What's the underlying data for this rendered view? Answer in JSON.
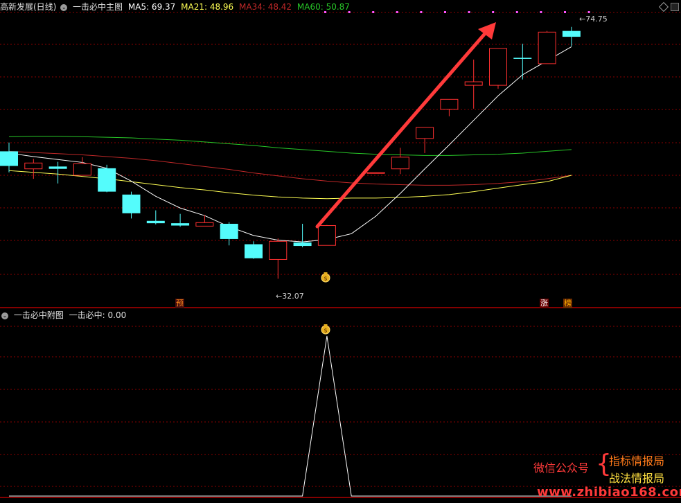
{
  "main_header": {
    "stock_title": "高新发展(日线)",
    "indicator_name": "一击必中主图",
    "ma5": "MA5: 69.37",
    "ma21": "MA21: 48.96",
    "ma34": "MA34: 48.42",
    "ma60": "MA60: 50.87"
  },
  "sub_header": {
    "indicator_name": "一击必中附图",
    "value": "一击必中: 0.00"
  },
  "price_labels": {
    "high": "74.75",
    "low": "32.07"
  },
  "badges": {
    "yu": "预",
    "zhang": "涨",
    "bang": "榜"
  },
  "colors": {
    "up": "#ff3030",
    "down": "#54fcfc",
    "ma5": "#ffffff",
    "ma21": "#ffff54",
    "ma34": "#c02828",
    "ma60": "#28c828",
    "grid": "#8b0000",
    "arrow": "#ff3a3a",
    "marker": "#ff54ff"
  },
  "icons": {
    "collapse": "chevron-down-icon",
    "signal": "money-bag-icon",
    "expand": "diamond-icon"
  },
  "watermark": {
    "left": "微信公众号",
    "right_top": "指标情报局",
    "right_bottom": "战法情报局",
    "url": "www.zhibiao168.com"
  },
  "chart_data": [
    {
      "type": "candlestick",
      "title": "高新发展(日线)",
      "ylim": [
        30,
        76
      ],
      "candles": [
        {
          "o": 53.9,
          "h": 55.4,
          "l": 50.3,
          "c": 51.4
        },
        {
          "o": 50.9,
          "h": 52.6,
          "l": 49.2,
          "c": 51.9
        },
        {
          "o": 51.3,
          "h": 52.1,
          "l": 48.4,
          "c": 50.9
        },
        {
          "o": 49.8,
          "h": 52.9,
          "l": 49.8,
          "c": 51.8
        },
        {
          "o": 51.0,
          "h": 51.6,
          "l": 46.9,
          "c": 47.0
        },
        {
          "o": 46.5,
          "h": 47.0,
          "l": 42.4,
          "c": 43.3
        },
        {
          "o": 42.0,
          "h": 43.8,
          "l": 41.4,
          "c": 41.6
        },
        {
          "o": 41.6,
          "h": 43.2,
          "l": 41.0,
          "c": 41.2
        },
        {
          "o": 41.1,
          "h": 43.0,
          "l": 41.1,
          "c": 41.7
        },
        {
          "o": 41.5,
          "h": 41.8,
          "l": 37.8,
          "c": 38.9
        },
        {
          "o": 38.0,
          "h": 38.5,
          "l": 35.5,
          "c": 35.6
        },
        {
          "o": 35.4,
          "h": 39.0,
          "l": 32.1,
          "c": 38.5
        },
        {
          "o": 38.3,
          "h": 41.5,
          "l": 37.5,
          "c": 37.7
        },
        {
          "o": 37.8,
          "h": 41.3,
          "l": 37.8,
          "c": 41.2
        },
        null,
        {
          "o": 50.3,
          "h": 50.3,
          "l": 50.3,
          "c": 50.3
        },
        {
          "o": 50.9,
          "h": 54.5,
          "l": 50.0,
          "c": 52.9
        },
        {
          "o": 56.1,
          "h": 56.6,
          "l": 53.6,
          "c": 58.0
        },
        {
          "o": 61.1,
          "h": 62.0,
          "l": 59.9,
          "c": 62.8
        },
        {
          "o": 65.2,
          "h": 69.6,
          "l": 61.2,
          "c": 65.8
        },
        {
          "o": 65.2,
          "h": 70.4,
          "l": 64.6,
          "c": 71.5
        },
        {
          "o": 69.9,
          "h": 72.3,
          "l": 66.2,
          "c": 69.8
        },
        {
          "o": 68.9,
          "h": 74.5,
          "l": 68.9,
          "c": 74.3
        },
        {
          "o": 74.5,
          "h": 75.2,
          "l": 71.9,
          "c": 73.5
        }
      ],
      "ma5": [
        53.6,
        53.0,
        52.5,
        52.0,
        51.0,
        48.8,
        46.2,
        44.2,
        42.9,
        41.0,
        39.5,
        38.7,
        38.4,
        38.8,
        39.8,
        42.8,
        46.7,
        50.9,
        55.0,
        59.2,
        63.4,
        67.0,
        69.4,
        71.8
      ],
      "ma21": [
        50.6,
        50.3,
        50.0,
        49.6,
        49.2,
        48.7,
        48.2,
        47.7,
        47.3,
        46.8,
        46.4,
        46.1,
        45.9,
        45.8,
        45.9,
        45.9,
        46.0,
        46.2,
        46.5,
        47.0,
        47.6,
        48.2,
        48.7,
        49.8
      ],
      "ma34": [
        53.9,
        53.7,
        53.5,
        53.3,
        53.0,
        52.7,
        52.3,
        51.8,
        51.3,
        50.8,
        50.2,
        49.7,
        49.2,
        48.8,
        48.5,
        48.3,
        48.2,
        48.1,
        48.1,
        48.2,
        48.4,
        48.7,
        49.2,
        49.8
      ],
      "ma60": [
        56.4,
        56.5,
        56.5,
        56.4,
        56.3,
        56.2,
        56.0,
        55.8,
        55.5,
        55.2,
        54.9,
        54.5,
        54.2,
        53.9,
        53.6,
        53.4,
        53.3,
        53.2,
        53.2,
        53.3,
        53.4,
        53.6,
        53.9,
        54.2
      ],
      "annotations": [
        "74.75",
        "32.07"
      ]
    },
    {
      "type": "line",
      "title": "一击必中附图",
      "ylim": [
        0,
        1
      ],
      "values": [
        0,
        0,
        0,
        0,
        0,
        0,
        0,
        0,
        0,
        0,
        0,
        0,
        0,
        1,
        0,
        0,
        0,
        0,
        0,
        0,
        0,
        0,
        0,
        0
      ]
    }
  ]
}
